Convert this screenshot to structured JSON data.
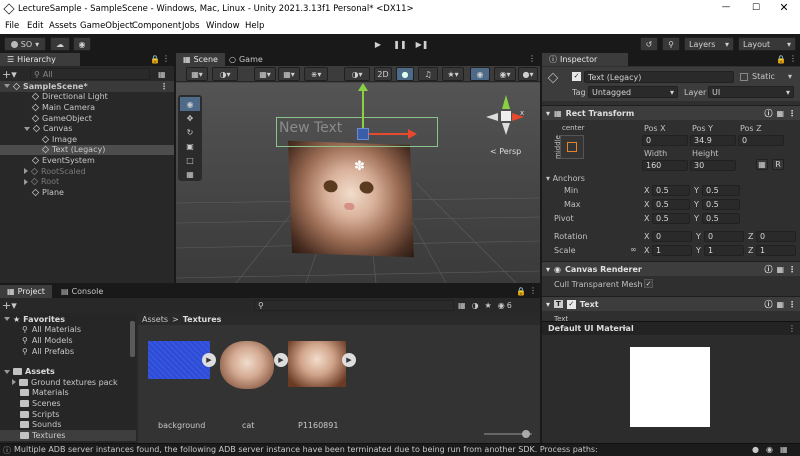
{
  "window": {
    "title": "LectureSample - SampleScene - Windows, Mac, Linux - Unity 2021.3.13f1 Personal* <DX11>"
  },
  "menu": {
    "items": [
      "File",
      "Edit",
      "Assets",
      "GameObject",
      "Component",
      "Jobs",
      "Window",
      "Help"
    ]
  },
  "toolbar": {
    "account": "SO",
    "layers": "Layers",
    "layout": "Layout"
  },
  "hierarchy": {
    "tab": "Hierarchy",
    "search_placeholder": "All",
    "scene": "SampleScene*",
    "items": [
      "Directional Light",
      "Main Camera",
      "GameObject",
      "Canvas",
      "Image",
      "Text (Legacy)",
      "EventSystem",
      "RootScaled",
      "Root",
      "Plane"
    ]
  },
  "scene": {
    "tabs": [
      "Scene",
      "Game"
    ],
    "mode_2d": "2D",
    "overlay_text": "New Text",
    "persp_label": "< Persp",
    "gizmo_x": "x"
  },
  "project": {
    "tabs": [
      "Project",
      "Console"
    ],
    "favorites_label": "Favorites",
    "favorites": [
      "All Materials",
      "All Models",
      "All Prefabs"
    ],
    "assets_label": "Assets",
    "assets": [
      "Ground textures pack",
      "Materials",
      "Scenes",
      "Scripts",
      "Sounds",
      "Textures"
    ],
    "breadcrumb": {
      "root": "Assets",
      "sep": ">",
      "current": "Textures"
    },
    "count": "6",
    "files": [
      "background",
      "cat",
      "P1160891"
    ]
  },
  "inspector": {
    "tab": "Inspector",
    "object_name": "Text (Legacy)",
    "static_label": "Static",
    "tag_label": "Tag",
    "tag_value": "Untagged",
    "layer_label": "Layer",
    "layer_value": "UI",
    "rect_transform": {
      "title": "Rect Transform",
      "anchor_h": "center",
      "anchor_v": "middle",
      "pos_x_label": "Pos X",
      "pos_y_label": "Pos Y",
      "pos_z_label": "Pos Z",
      "pos_x": "0",
      "pos_y": "34.9",
      "pos_z": "0",
      "width_label": "Width",
      "height_label": "Height",
      "width": "160",
      "height": "30",
      "r_label": "R",
      "anchors_label": "Anchors",
      "min_label": "Min",
      "max_label": "Max",
      "min_x": "0.5",
      "min_y": "0.5",
      "max_x": "0.5",
      "max_y": "0.5",
      "pivot_label": "Pivot",
      "pivot_x": "0.5",
      "pivot_y": "0.5",
      "rotation_label": "Rotation",
      "rot_x": "0",
      "rot_y": "0",
      "rot_z": "0",
      "scale_label": "Scale",
      "scale_x": "1",
      "scale_y": "1",
      "scale_z": "1",
      "x": "X",
      "y": "Y",
      "z": "Z"
    },
    "canvas_renderer": {
      "title": "Canvas Renderer",
      "cull_label": "Cull Transparent Mesh"
    },
    "text": {
      "title": "Text",
      "field_label": "Text"
    },
    "material": "Default UI Material"
  },
  "status": {
    "message": "Multiple ADB server instances found, the following ADB server instance have been terminated due to being run from another SDK. Process paths:"
  },
  "colors": {
    "accent": "#2c5d87",
    "selected": "#2c5d87",
    "bg": "#282828"
  }
}
